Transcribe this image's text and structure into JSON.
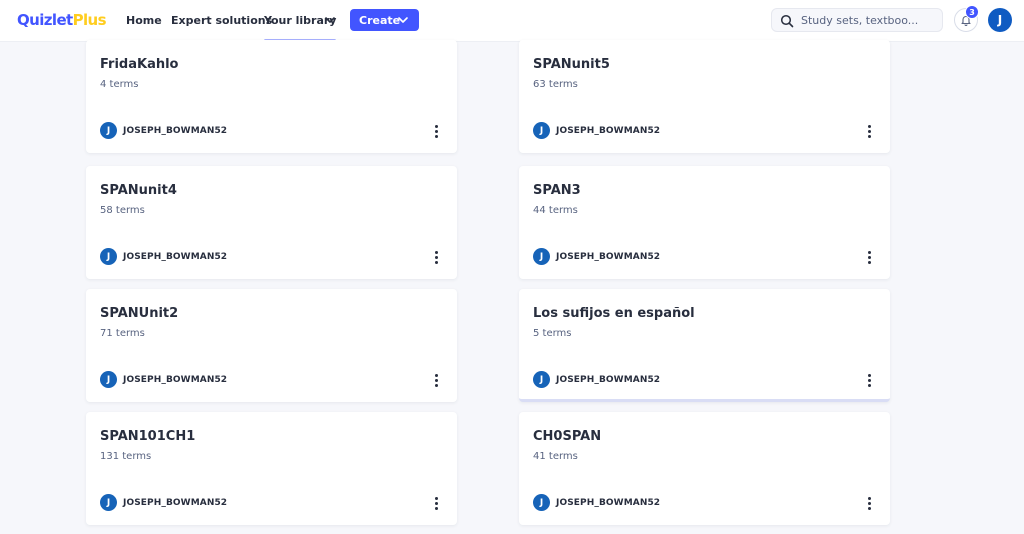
{
  "brand": {
    "quizlet": "Quizlet",
    "plus": "Plus"
  },
  "nav": {
    "home": "Home",
    "expert": "Expert solutions",
    "library": "Your library",
    "create": "Create"
  },
  "search": {
    "placeholder": "Study sets, textboo..."
  },
  "notifications": {
    "count": "3"
  },
  "user": {
    "initial": "J"
  },
  "cards": [
    {
      "title": "FridaKahlo",
      "terms": "4 terms",
      "owner": "JOSEPH_BOWMAN52",
      "initial": "J"
    },
    {
      "title": "SPANunit5",
      "terms": "63 terms",
      "owner": "JOSEPH_BOWMAN52",
      "initial": "J"
    },
    {
      "title": "SPANunit4",
      "terms": "58 terms",
      "owner": "JOSEPH_BOWMAN52",
      "initial": "J"
    },
    {
      "title": "SPAN3",
      "terms": "44 terms",
      "owner": "JOSEPH_BOWMAN52",
      "initial": "J"
    },
    {
      "title": "SPANUnit2",
      "terms": "71 terms",
      "owner": "JOSEPH_BOWMAN52",
      "initial": "J"
    },
    {
      "title": "Los sufijos en español",
      "terms": "5 terms",
      "owner": "JOSEPH_BOWMAN52",
      "initial": "J"
    },
    {
      "title": "SPAN101CH1",
      "terms": "131 terms",
      "owner": "JOSEPH_BOWMAN52",
      "initial": "J"
    },
    {
      "title": "CH0SPAN",
      "terms": "41 terms",
      "owner": "JOSEPH_BOWMAN52",
      "initial": "J"
    }
  ]
}
